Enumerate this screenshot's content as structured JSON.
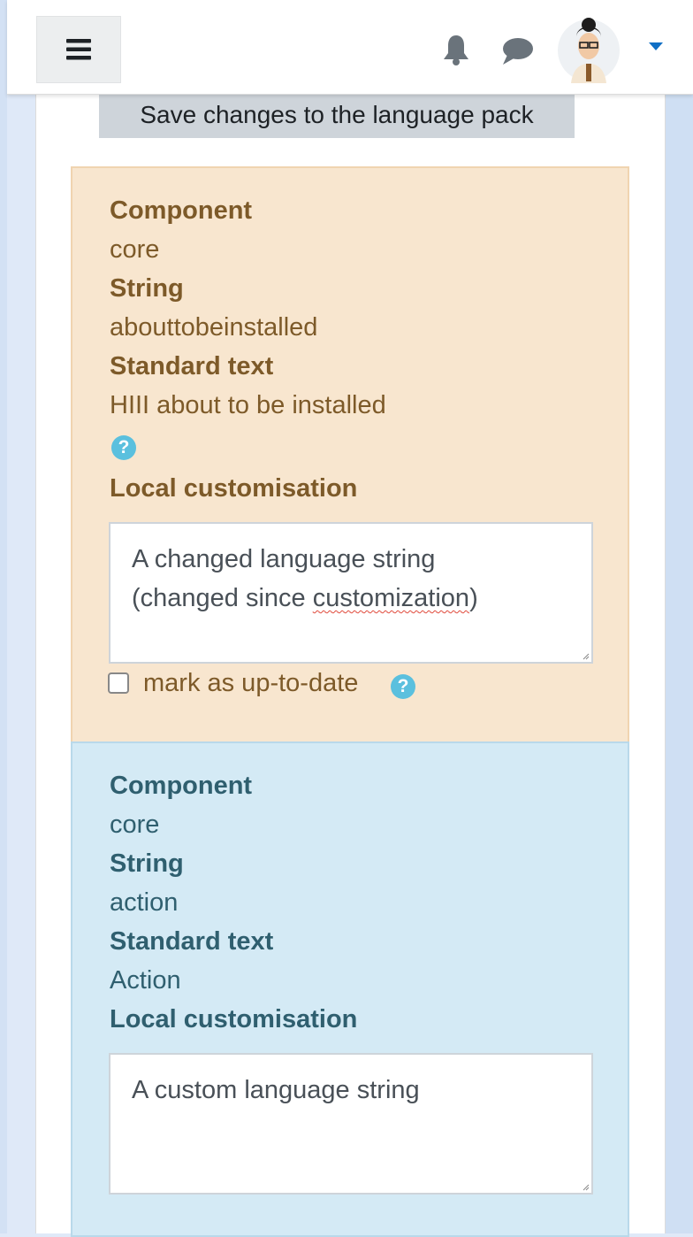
{
  "header": {
    "menu_icon": "hamburger-icon",
    "notification_icon": "bell-icon",
    "messages_icon": "chat-bubble-icon",
    "user_menu_icon": "caret-down-icon",
    "accent_color": "#0f6fc5"
  },
  "actions": {
    "save_label": "Save changes to the language pack"
  },
  "strings": [
    {
      "status": "warning",
      "component_label": "Component",
      "component": "core",
      "string_label": "String",
      "string_id": "abouttobeinstalled",
      "standard_label": "Standard text",
      "standard_text": "HIII about to be installed",
      "custom_label": "Local customisation",
      "custom_value_part1": "A changed language string\n(changed since ",
      "custom_value_misspelled": "customization",
      "custom_value_part2": ")",
      "uptodate_label": "mark as up-to-date",
      "uptodate_checked": false,
      "bg_color": "#f8e6cf"
    },
    {
      "status": "info",
      "component_label": "Component",
      "component": "core",
      "string_label": "String",
      "string_id": "action",
      "standard_label": "Standard text",
      "standard_text": "Action",
      "custom_label": "Local customisation",
      "custom_value": "A custom language string",
      "bg_color": "#d4eaf5"
    }
  ]
}
